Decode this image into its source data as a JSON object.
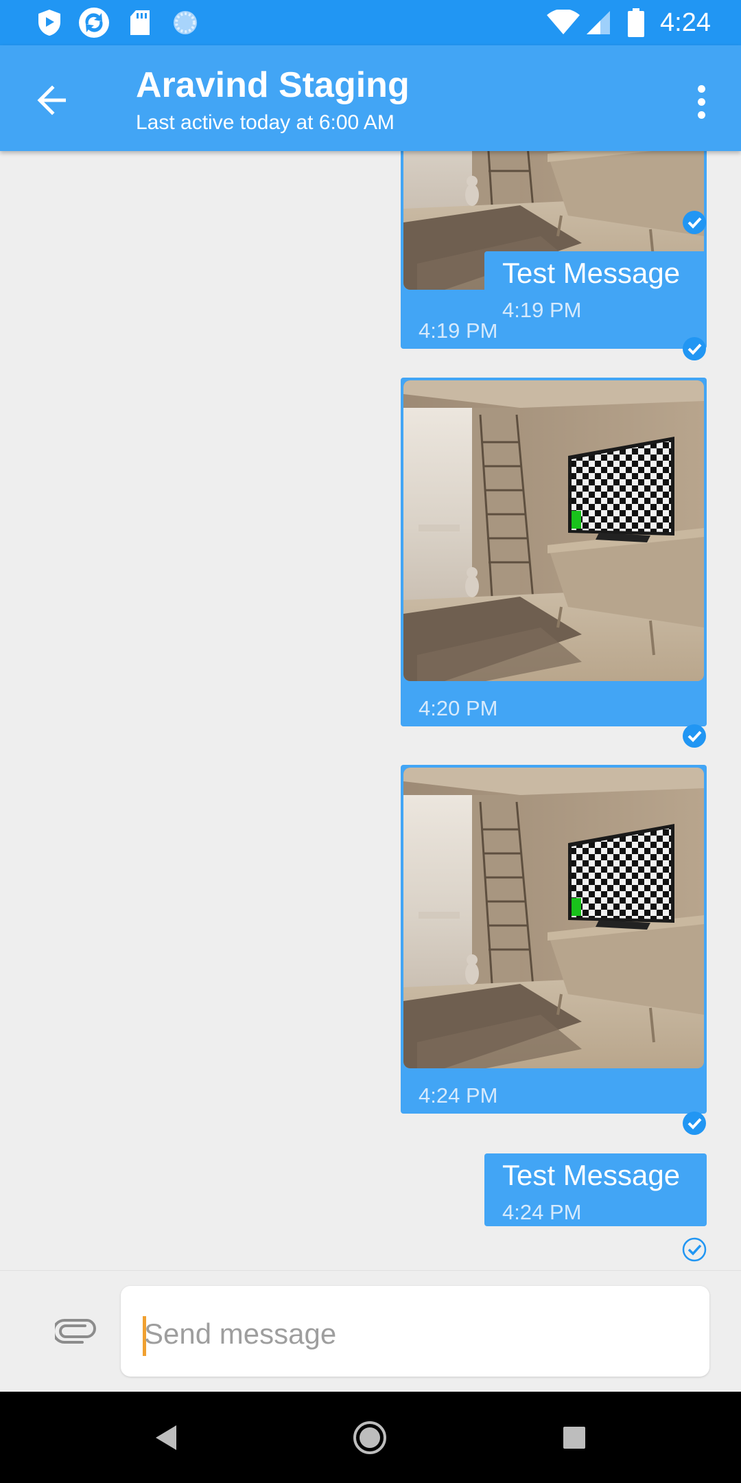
{
  "status_bar": {
    "time": "4:24",
    "icons_left": [
      "shield-app-icon",
      "sync-app-icon",
      "sd-card-icon",
      "loading-spinner-icon"
    ],
    "icons_right": [
      "wifi-icon",
      "cellular-signal-icon",
      "battery-icon"
    ]
  },
  "header": {
    "title": "Aravind Staging",
    "subtitle": "Last active today at 6:00 AM"
  },
  "messages": [
    {
      "type": "image",
      "time": "4:19 PM",
      "status": "read"
    },
    {
      "type": "text",
      "text": "Test Message",
      "time": "4:19 PM",
      "status": "read"
    },
    {
      "type": "image",
      "time": "4:20 PM",
      "status": "read"
    },
    {
      "type": "image",
      "time": "4:24 PM",
      "status": "read"
    },
    {
      "type": "text",
      "text": "Test Message",
      "time": "4:24 PM",
      "status": "delivered"
    }
  ],
  "composer": {
    "placeholder": "Send message"
  },
  "colors": {
    "status_bar": "#2196f3",
    "app_bar": "#42a5f5",
    "bubble": "#42a5f5",
    "background": "#eeeeee",
    "caret": "#f0a030"
  }
}
